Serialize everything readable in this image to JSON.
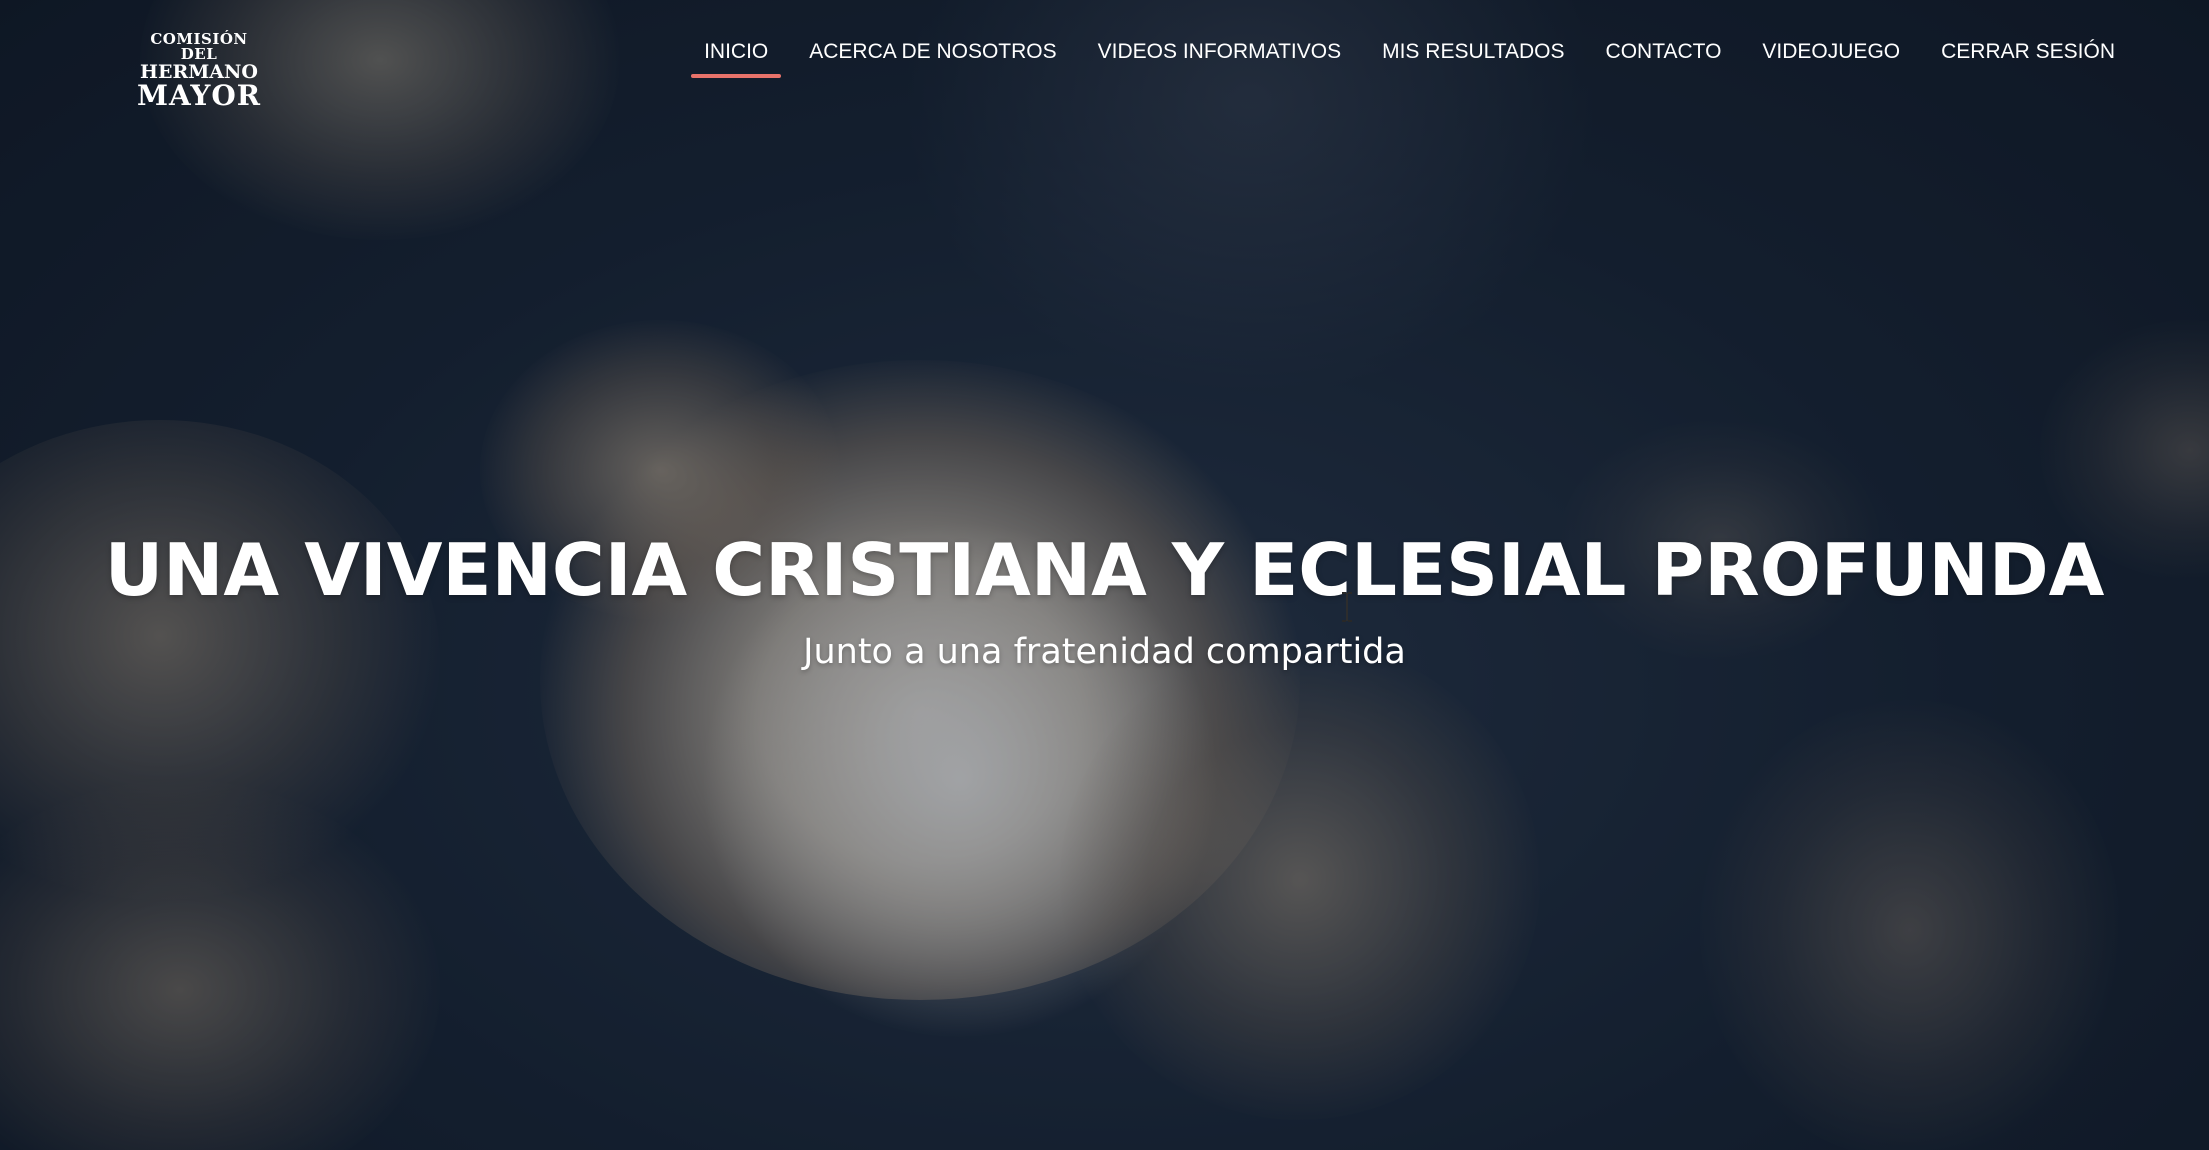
{
  "logo": {
    "line1": "COMISIÓN DEL",
    "line2": "HERMANO",
    "line3": "MAYOR"
  },
  "nav": {
    "items": [
      {
        "label": "INICIO",
        "active": true
      },
      {
        "label": "ACERCA DE NOSOTROS",
        "active": false
      },
      {
        "label": "VIDEOS INFORMATIVOS",
        "active": false
      },
      {
        "label": "MIS RESULTADOS",
        "active": false
      },
      {
        "label": "CONTACTO",
        "active": false
      },
      {
        "label": "VIDEOJUEGO",
        "active": false
      },
      {
        "label": "CERRAR SESIÓN",
        "active": false
      }
    ]
  },
  "hero": {
    "title": "UNA VIVENCIA CRISTIANA Y ECLESIAL PROFUNDA",
    "subtitle": "Junto a una fratenidad compartida"
  },
  "colors": {
    "accent": "#e8726a",
    "sky_dark": "#1a2638",
    "cloud": "#c9b59c"
  },
  "icons": {
    "cursor": "text-cursor-icon"
  }
}
